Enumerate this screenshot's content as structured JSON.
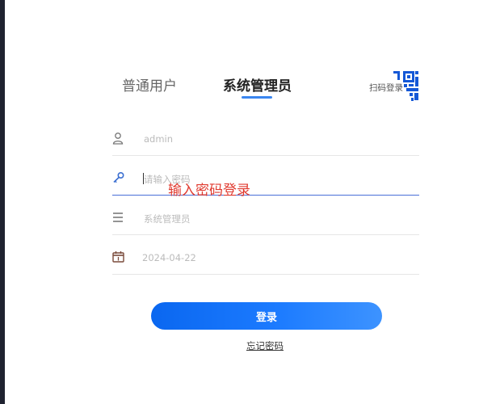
{
  "tabs": {
    "user": "普通用户",
    "admin": "系统管理员"
  },
  "qr": {
    "label": "扫码登录"
  },
  "form": {
    "username_value": "admin",
    "password_placeholder": "请输入密码",
    "role_value": "系统管理员",
    "date_value": "2024-04-22",
    "hint": "输入密码登录"
  },
  "actions": {
    "login_label": "登录",
    "forgot_label": "忘记密码"
  },
  "colors": {
    "accent": "#1c7bff",
    "hint": "#e03a2f",
    "tab_underline": "#3a86f0"
  },
  "icons": {
    "username": "user-icon",
    "password": "key-icon",
    "role": "menu-icon",
    "date": "calendar-icon",
    "qr": "qr-code-icon"
  }
}
